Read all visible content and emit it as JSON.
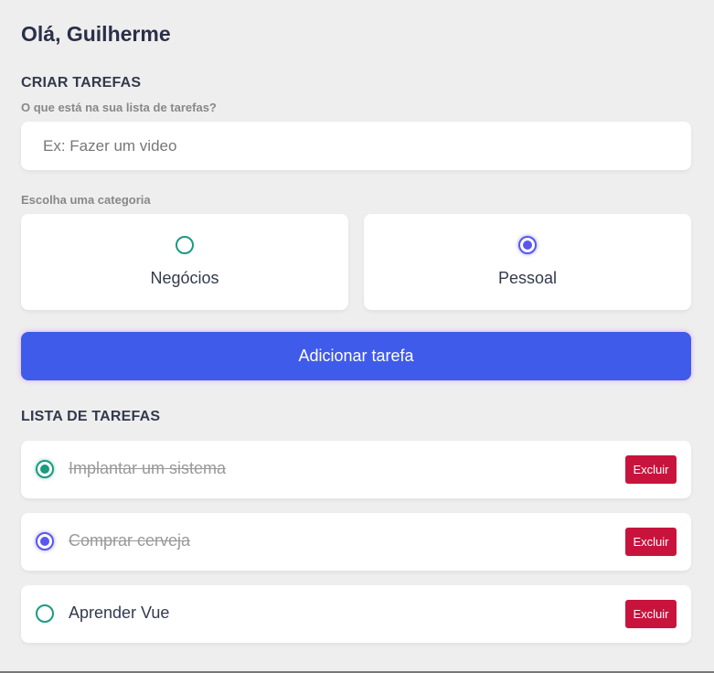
{
  "greeting": "Olá, Guilherme",
  "create": {
    "title": "CRIAR TAREFAS",
    "question": "O que está na sua lista de tarefas?",
    "input_placeholder": "Ex: Fazer um video",
    "input_value": "",
    "category_label": "Escolha uma categoria",
    "categories": [
      {
        "label": "Negócios",
        "selected": false,
        "color": "#1b9a80"
      },
      {
        "label": "Pessoal",
        "selected": true,
        "color": "#5a57ee"
      }
    ],
    "add_button": "Adicionar tarefa"
  },
  "list": {
    "title": "LISTA DE TAREFAS",
    "delete_label": "Excluir",
    "tasks": [
      {
        "text": "Implantar um sistema",
        "category": "business",
        "done": true
      },
      {
        "text": "Comprar cerveja",
        "category": "personal",
        "done": true
      },
      {
        "text": "Aprender Vue",
        "category": "business",
        "done": false
      }
    ]
  },
  "colors": {
    "primary": "#3f5bea",
    "danger": "#c8143c",
    "business": "#1b9a80",
    "personal": "#5a57ee",
    "background": "#eeeeee"
  }
}
